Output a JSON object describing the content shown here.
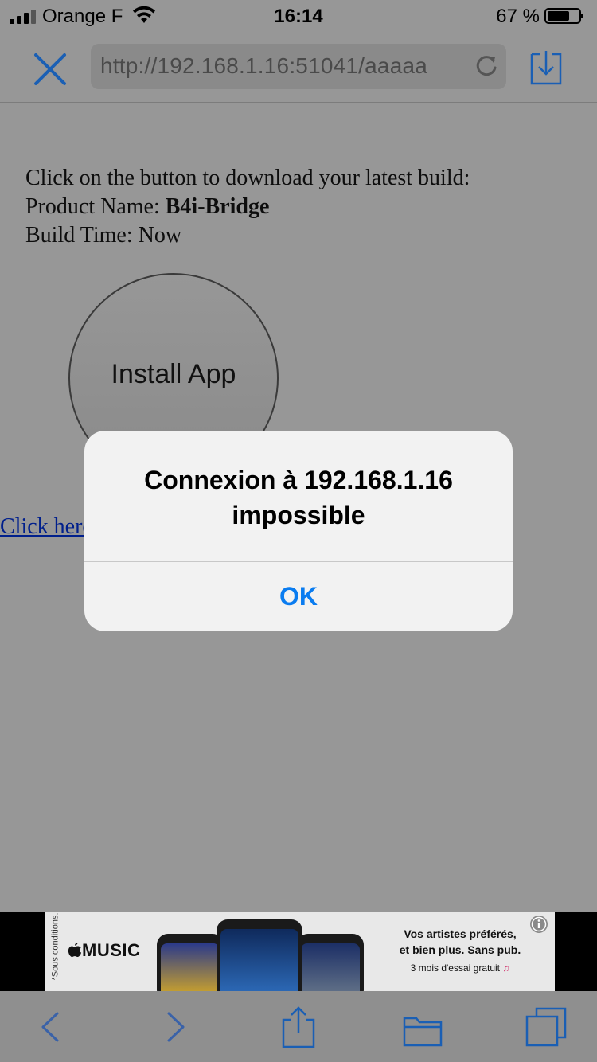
{
  "status_bar": {
    "carrier": "Orange F",
    "time": "16:14",
    "battery": "67 %"
  },
  "nav": {
    "url": "http://192.168.1.16:51041/aaaaa"
  },
  "page": {
    "line1": "Click on the button to download your latest build:",
    "product_label": "Product Name: ",
    "product_name": "B4i-Bridge",
    "build_time": "Build Time: Now",
    "install_button": "Install App",
    "link_text": "Click here"
  },
  "alert": {
    "title": "Connexion à 192.168.1.16 impossible",
    "ok": "OK"
  },
  "ad": {
    "terms": "*Sous conditions.",
    "brand": "MUSIC",
    "line1": "Vos artistes préférés,",
    "line2": "et bien plus. Sans pub.",
    "line3": "3 mois d'essai gratuit"
  },
  "colors": {
    "accent": "#0a7cf0",
    "nav_icon": "#1a5fb4",
    "dim_background": "#979797"
  }
}
